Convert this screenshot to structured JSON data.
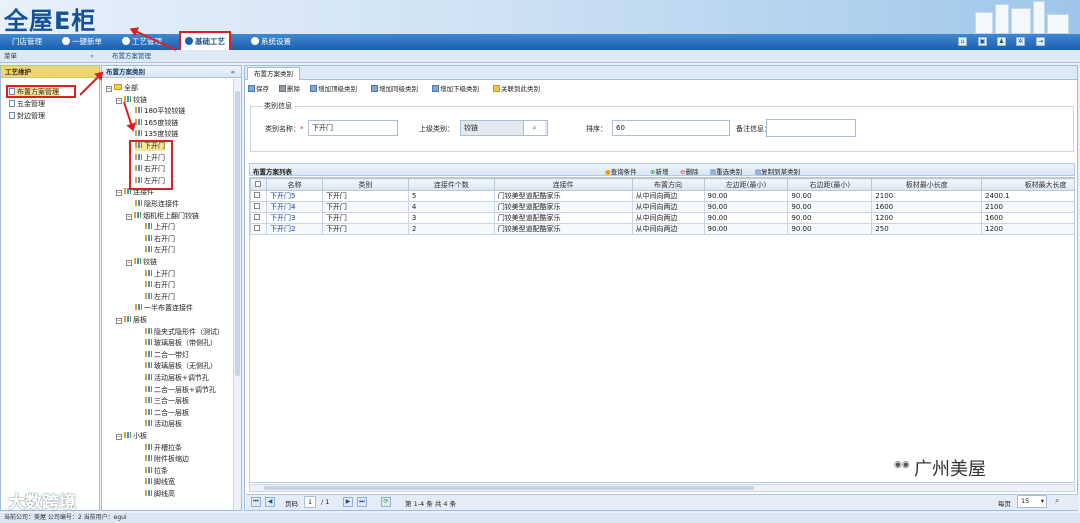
{
  "brand": {
    "logo": "全屋E柜"
  },
  "nav": {
    "items": [
      "门店管理",
      "一键新单",
      "工艺管理",
      "基础工艺",
      "系统设置"
    ],
    "active": "基础工艺"
  },
  "toolbar_icons": [
    "home-icon",
    "save-icon",
    "user-icon",
    "gear-icon",
    "logout-icon"
  ],
  "menubar": {
    "left": "菜单",
    "collapse": "«",
    "breadcrumb": "布置方案管理"
  },
  "left_panel": {
    "title": "工艺维护",
    "items": [
      "布置方案管理",
      "五金管理",
      "封边管理"
    ]
  },
  "tree_panel": {
    "title": "布置方案类别",
    "collapse": "«",
    "nodes": [
      {
        "label": "全部",
        "level": 0,
        "type": "folder",
        "exp": "⊟"
      },
      {
        "label": "铰链",
        "level": 1,
        "type": "cat",
        "exp": "⊟"
      },
      {
        "label": "180平铰铰链",
        "level": 2,
        "type": "cat"
      },
      {
        "label": "165度铰链",
        "level": 2,
        "type": "cat"
      },
      {
        "label": "135度铰链",
        "level": 2,
        "type": "cat"
      },
      {
        "label": "下开门",
        "level": 2,
        "type": "cat",
        "sel": true
      },
      {
        "label": "上开门",
        "level": 2,
        "type": "cat"
      },
      {
        "label": "右开门",
        "level": 2,
        "type": "cat"
      },
      {
        "label": "左开门",
        "level": 2,
        "type": "cat"
      },
      {
        "label": "连接件",
        "level": 1,
        "type": "cat",
        "exp": "⊟"
      },
      {
        "label": "隐形连接件",
        "level": 2,
        "type": "cat"
      },
      {
        "label": "烟机柜上翻门铰链",
        "level": 2,
        "type": "cat",
        "exp": "⊟"
      },
      {
        "label": "上开门",
        "level": 3,
        "type": "cat"
      },
      {
        "label": "右开门",
        "level": 3,
        "type": "cat"
      },
      {
        "label": "左开门",
        "level": 3,
        "type": "cat"
      },
      {
        "label": "铰链",
        "level": 2,
        "type": "cat",
        "exp": "⊟"
      },
      {
        "label": "上开门",
        "level": 3,
        "type": "cat"
      },
      {
        "label": "右开门",
        "level": 3,
        "type": "cat"
      },
      {
        "label": "左开门",
        "level": 3,
        "type": "cat"
      },
      {
        "label": "一半布置连接件",
        "level": 2,
        "type": "cat"
      },
      {
        "label": "层板",
        "level": 1,
        "type": "cat",
        "exp": "⊟"
      },
      {
        "label": "隐夹式隐形件（测试）",
        "level": 3,
        "type": "cat"
      },
      {
        "label": "玻璃层板（带侧孔）",
        "level": 3,
        "type": "cat"
      },
      {
        "label": "二合一带灯",
        "level": 3,
        "type": "cat"
      },
      {
        "label": "玻璃层板（无侧孔）",
        "level": 3,
        "type": "cat"
      },
      {
        "label": "活动层板+调节孔",
        "level": 3,
        "type": "cat"
      },
      {
        "label": "二合一层板+调节孔",
        "level": 3,
        "type": "cat"
      },
      {
        "label": "三合一层板",
        "level": 3,
        "type": "cat"
      },
      {
        "label": "二合一层板",
        "level": 3,
        "type": "cat"
      },
      {
        "label": "活动层板",
        "level": 3,
        "type": "cat"
      },
      {
        "label": "小板",
        "level": 1,
        "type": "cat",
        "exp": "⊟"
      },
      {
        "label": "开槽拉条",
        "level": 3,
        "type": "cat"
      },
      {
        "label": "附件板缩边",
        "level": 3,
        "type": "cat"
      },
      {
        "label": "拉条",
        "level": 3,
        "type": "cat"
      },
      {
        "label": "脚线宽",
        "level": 3,
        "type": "cat"
      },
      {
        "label": "脚线高",
        "level": 3,
        "type": "cat"
      }
    ]
  },
  "main": {
    "tab": "布置方案类别",
    "toolbar": [
      "保存",
      "删除",
      "增加顶级类别",
      "增加同级类别",
      "增加下级类别",
      "关联到此类别"
    ],
    "form": {
      "legend": "类别信息",
      "name_label": "类别名称：",
      "name_value": "下开门",
      "parent_label": "上级类别：",
      "parent_value": "铰链",
      "order_label": "排序：",
      "order_value": "60",
      "note_label": "备注信息：",
      "note_value": ""
    },
    "list": {
      "title": "布置方案列表",
      "actions": [
        "查询条件",
        "新增",
        "删除",
        "重选类别",
        "复制到某类别"
      ],
      "columns": [
        "名称",
        "类别",
        "连接件个数",
        "连接件",
        "布置方向",
        "左边距(最小)",
        "右边距(最小)",
        "板材最小长度",
        "板材最大长度"
      ],
      "rows": [
        [
          "下开门5",
          "下开门",
          "5",
          "门铰美型道配酷家乐",
          "从中间向两边",
          "90.00",
          "90.00",
          "2100",
          "2400.1"
        ],
        [
          "下开门4",
          "下开门",
          "4",
          "门铰美型道配酷家乐",
          "从中间向两边",
          "90.00",
          "90.00",
          "1600",
          "2100"
        ],
        [
          "下开门3",
          "下开门",
          "3",
          "门铰美型道配酷家乐",
          "从中间向两边",
          "90.00",
          "90.00",
          "1200",
          "1600"
        ],
        [
          "下开门2",
          "下开门",
          "2",
          "门铰美型道配酷家乐",
          "从中间向两边",
          "90.00",
          "90.00",
          "250",
          "1200"
        ]
      ]
    },
    "pager": {
      "page_label": "页码",
      "page": "1",
      "total": "/ 1",
      "summary": "第 1-4 条  共 4 条",
      "per_page_label": "每页",
      "per_page": "15"
    }
  },
  "footer": {
    "text": "当前公司：美屋   公司编号：2   当前用户：egui"
  },
  "watermark": {
    "left": "大数跨境",
    "right": "广州美屋"
  },
  "colors": {
    "nav": "#1d5fae",
    "highlight": "#e02020",
    "link": "#1a3fb6"
  }
}
